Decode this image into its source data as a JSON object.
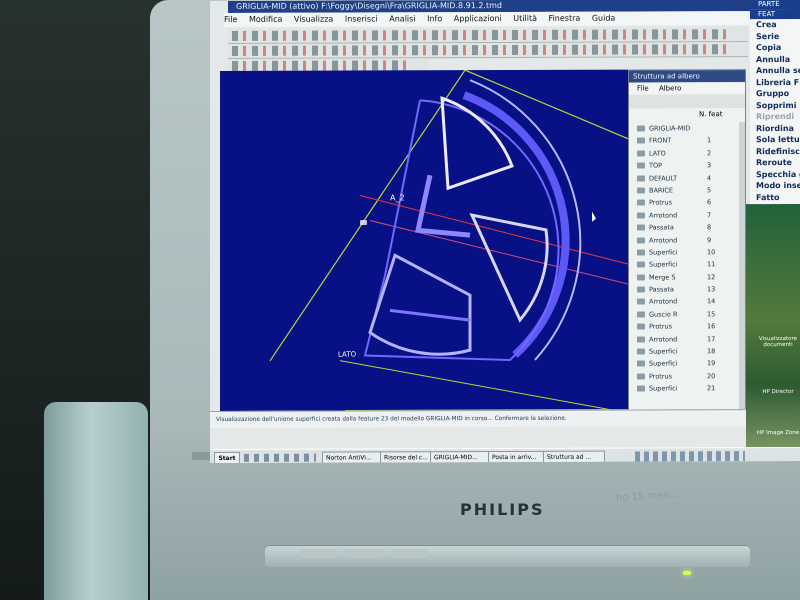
{
  "screen": {
    "title": "GRIGLIA-MID (attivo) F:\\Foggy\\Disegni\\Fra\\GRIGLIA-MID.8.91.2.tmd",
    "menu": [
      "File",
      "Modifica",
      "Visualizza",
      "Inserisci",
      "Analisi",
      "Info",
      "Applicazioni",
      "Utilità",
      "Finestra",
      "Guida"
    ],
    "right_menu": {
      "header_parte": "PARTE",
      "header_feat": "FEAT",
      "items": [
        "Crea",
        "Serie",
        "Copia",
        "Annulla",
        "Annulla serie",
        "Libreria FDU",
        "Gruppo",
        "Sopprimi",
        "Riprendi",
        "Riordina",
        "Sola lettura",
        "Ridefinisci",
        "Reroute",
        "Specchia geo",
        "Modo inserisci",
        "Fatto"
      ]
    },
    "model_tree": {
      "title": "Struttura ad albero",
      "menu": [
        "File",
        "Albero"
      ],
      "column": "N. feat",
      "rows": [
        {
          "label": "GRIGLIA-MID",
          "num": ""
        },
        {
          "label": "FRONT",
          "num": "1"
        },
        {
          "label": "LATO",
          "num": "2"
        },
        {
          "label": "TOP",
          "num": "3"
        },
        {
          "label": "DEFAULT",
          "num": "4"
        },
        {
          "label": "BARICE",
          "num": "5"
        },
        {
          "label": "Protrus",
          "num": "6"
        },
        {
          "label": "Arrotond",
          "num": "7"
        },
        {
          "label": "Passata",
          "num": "8"
        },
        {
          "label": "Arrotond",
          "num": "9"
        },
        {
          "label": "Superfici",
          "num": "10"
        },
        {
          "label": "Superfici",
          "num": "11"
        },
        {
          "label": "Merge S",
          "num": "12"
        },
        {
          "label": "Passata",
          "num": "13"
        },
        {
          "label": "Arrotond",
          "num": "14"
        },
        {
          "label": "Guscio R",
          "num": "15"
        },
        {
          "label": "Protrus",
          "num": "16"
        },
        {
          "label": "Arrotond",
          "num": "17"
        },
        {
          "label": "Superfici",
          "num": "18"
        },
        {
          "label": "Superfici",
          "num": "19"
        },
        {
          "label": "Protrus",
          "num": "20"
        },
        {
          "label": "Superfici",
          "num": "21"
        }
      ]
    },
    "status_message": "Visualizzazione dell'unione superfici creata dalla feature 23 del modello GRIGLIA-MID in corso... Confermare la selezione.",
    "taskbar": {
      "start": "Start",
      "buttons": [
        "Norton AntiVi...",
        "Risorse del c...",
        "GRIGLIA-MID...",
        "Posta in arriv...",
        "Struttura ad ..."
      ]
    },
    "desktop_icons": [
      "Visualizzatore documenti",
      "HP Director",
      "HP Image Zone"
    ],
    "viewport_labels": {
      "axis": "A_2",
      "plane": "LATO"
    }
  },
  "monitor": {
    "brand": "PHILIPS",
    "note": "ho 15 mesi ..."
  }
}
